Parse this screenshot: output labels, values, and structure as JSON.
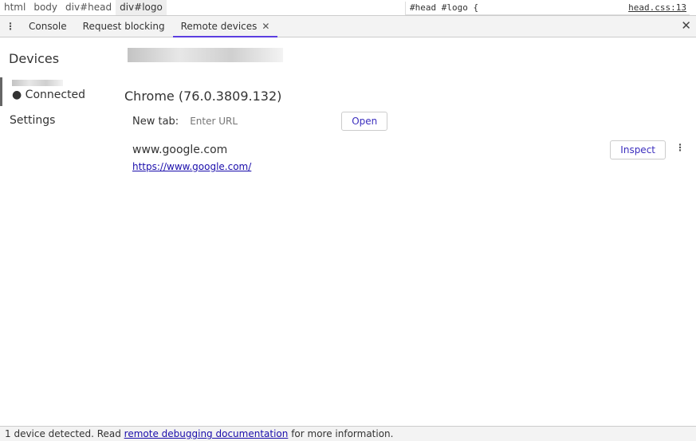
{
  "breadcrumbs": [
    "html",
    "body",
    "div#head",
    "div#logo"
  ],
  "styles": {
    "selector": "#head #logo {",
    "source": "head.css:13"
  },
  "tabs": [
    {
      "label": "Console"
    },
    {
      "label": "Request blocking"
    },
    {
      "label": "Remote devices"
    }
  ],
  "sidebar": {
    "title": "Devices",
    "device_status": "Connected",
    "settings": "Settings"
  },
  "main": {
    "browser": "Chrome (76.0.3809.132)",
    "new_tab_label": "New tab:",
    "url_placeholder": "Enter URL",
    "open_label": "Open",
    "page": {
      "title": "www.google.com",
      "url": "https://www.google.com/",
      "inspect_label": "Inspect"
    }
  },
  "status": {
    "prefix": "1 device detected. Read ",
    "link": "remote debugging documentation",
    "suffix": " for more information."
  },
  "colors": {
    "accent": "#5b3ee0",
    "link": "#1a0dab"
  }
}
